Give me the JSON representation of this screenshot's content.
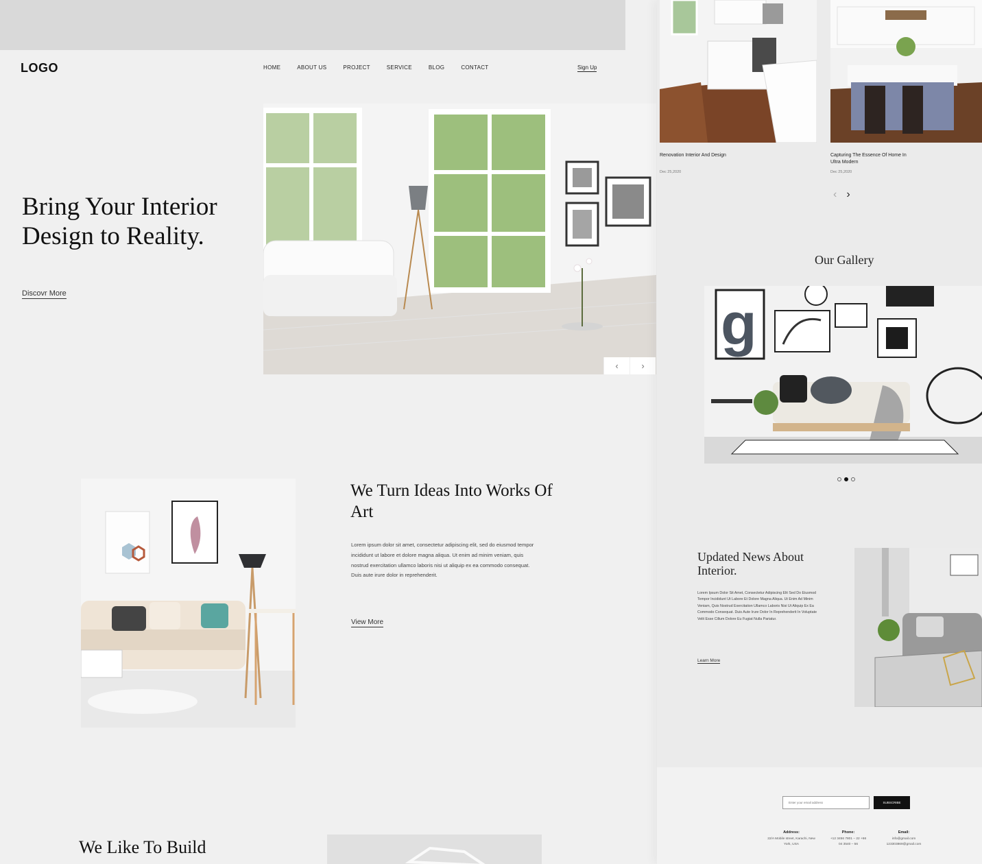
{
  "header": {
    "logo": "LOGO",
    "nav": [
      "HOME",
      "ABOUT US",
      "PROJECT",
      "SERVICE",
      "BLOG",
      "CONTACT"
    ],
    "signup": "Sign Up"
  },
  "hero": {
    "title": "Bring Your Interior Design to Reality.",
    "cta": "Discovr More",
    "prev_icon": "‹",
    "next_icon": "›"
  },
  "about": {
    "title": "We Turn Ideas Into Works Of Art",
    "body": "Lorem ipsum dolor sit amet, consectetur adipiscing elit, sed do eiusmod tempor incididunt ut labore et dolore magna aliqua. Ut enim ad minim veniam, quis nostrud exercitation ullamco laboris nisi ut aliquip ex ea commodo consequat. Duis aute irure dolor in reprehenderit.",
    "cta": "View More"
  },
  "build": {
    "title": "We Like To Build"
  },
  "blog": {
    "posts": [
      {
        "title": "Renovation Interior And Design",
        "date": "Dec 25,2020"
      },
      {
        "title": "Capturing The Essence Of Home In Ultra Modern",
        "date": "Dec 25,2020"
      }
    ],
    "prev_icon": "‹",
    "next_icon": "›"
  },
  "gallery": {
    "title": "Our Gallery",
    "active_dot": 2
  },
  "news": {
    "title": "Updated News About Interior.",
    "body": "Lorem Ipsum Dolor Sit Amet, Consectetur Adipiscing Elit Sed Do Eiusmod Tempor Incididunt Ut Labore Et Dolore Magna Aliqua. Ut Enim Ad Minim Veniam, Quis Nostrud Exercitation Ullamco Laboris Nisi Ut Aliquip Ex Ea Commodo Consequat. Duis Aute Irure Dolor In Reprehenderit In Voluptate Velit Esse Cillum Dolore Eu Fugiat Nulla Pariatur.",
    "cta": "Learn More"
  },
  "footer": {
    "email_placeholder": "Enter your email address",
    "subscribe": "SUBSCRIBE",
    "address_label": "Address:",
    "address": "22/A Mobile street, Karachi, New York, USA",
    "phone_label": "Phone:",
    "phone": "+12 3456 7801 – 22 +66 04 3540 – 56",
    "email_label": "Email:",
    "email": "info@gmail.com 123303869@gmail.com"
  }
}
